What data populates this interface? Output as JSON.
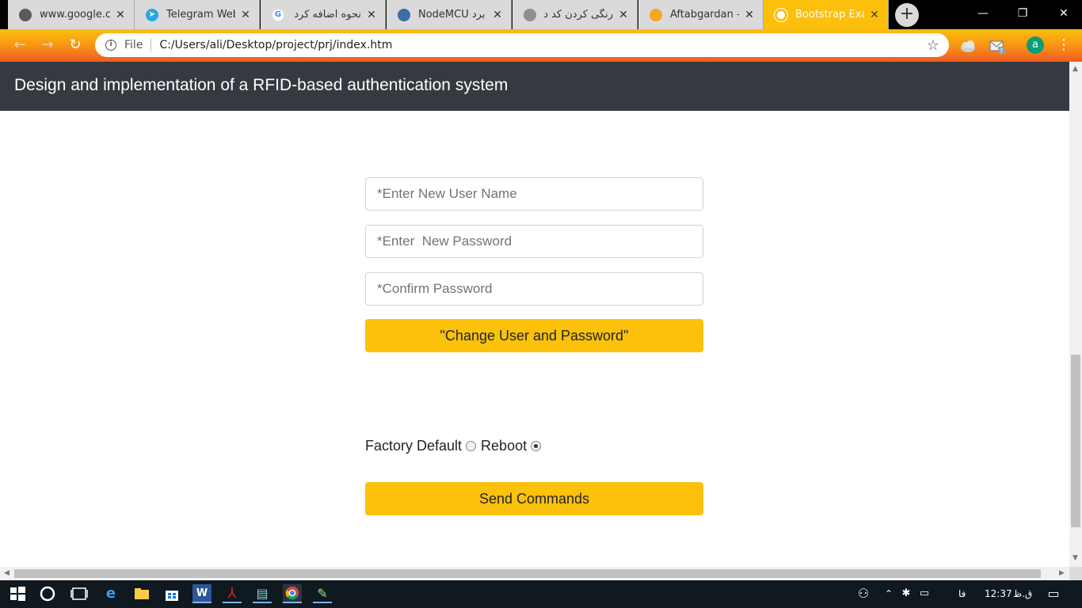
{
  "browser": {
    "tabs": [
      {
        "title": "www.google.co",
        "favicon_color": "#5a5a5a"
      },
      {
        "title": "Telegram Web",
        "favicon_color": "#2ca5e0"
      },
      {
        "title": "نحوه اضافه کرد",
        "favicon_color": "#4285f4"
      },
      {
        "title": "NodeMCU برد -",
        "favicon_color": "#3a6ea5"
      },
      {
        "title": "رنگی کردن کد د",
        "favicon_color": "#8e8e8e"
      },
      {
        "title": "Aftabgardan -",
        "favicon_color": "#f5a623"
      },
      {
        "title": "Bootstrap Exam",
        "favicon_color": "#ffffff"
      }
    ],
    "new_tab_label": "+",
    "window_controls": {
      "minimize": "—",
      "restore": "❐",
      "close": "✕"
    },
    "address_bar": {
      "scheme_label": "File",
      "url": "C:/Users/ali/Desktop/project/prj/index.htm"
    },
    "profile_initial": "a"
  },
  "page": {
    "brand_title": "Design and implementation of a RFID-based authentication system",
    "form": {
      "username_placeholder": "*Enter New User Name",
      "password_placeholder": "*Enter  New Password",
      "confirm_placeholder": "*Confirm Password",
      "change_button_label": "\"Change User and Password\""
    },
    "commands": {
      "factory_default_label": "Factory Default",
      "reboot_label": "Reboot",
      "selected": "reboot",
      "send_button_label": "Send Commands"
    }
  },
  "taskbar": {
    "language": "فا",
    "time": "12:37",
    "period": "ق.ظ"
  },
  "colors": {
    "navbar": "#343a40",
    "warning": "#fcc10a",
    "chrome_accent": "#f79515"
  }
}
